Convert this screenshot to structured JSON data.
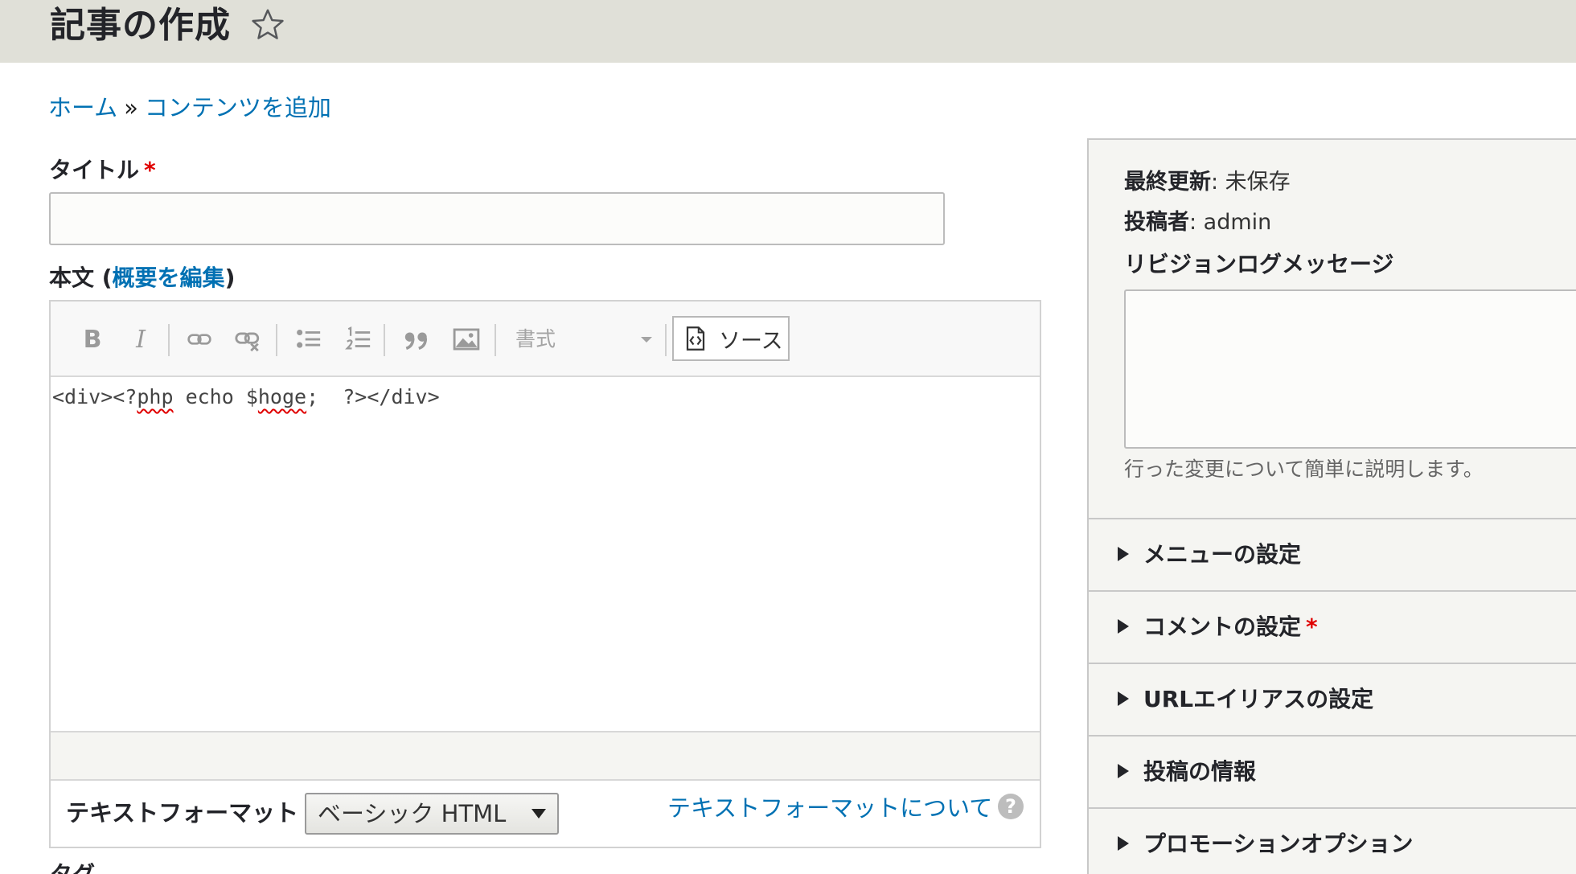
{
  "header": {
    "title": "記事の作成",
    "star_icon": "star-outline-icon"
  },
  "breadcrumb": {
    "home": "ホーム",
    "separator": "»",
    "add_content": "コンテンツを追加"
  },
  "title_field": {
    "label": "タイトル",
    "required_mark": "*",
    "value": ""
  },
  "body_field": {
    "label": "本文 (",
    "edit_summary": "概要を編集",
    "label_close": ")",
    "toolbar": {
      "bold": "B",
      "italic": "I",
      "format_placeholder": "書式",
      "source_label": "ソース"
    },
    "content": {
      "part1": "<div><?",
      "word1": "php",
      "part2": " echo $",
      "word2": "hoge",
      "part3": ";  ?></div>"
    },
    "text_format": {
      "label": "テキストフォーマット",
      "selected": "ベーシック HTML",
      "about_link": "テキストフォーマットについて",
      "help": "?"
    }
  },
  "next_label_partial": "タグ",
  "sidebar": {
    "last_updated_label": "最終更新",
    "last_updated_value": ": 未保存",
    "author_label": "投稿者",
    "author_value": ": admin",
    "revision_label": "リビジョンログメッセージ",
    "revision_value": "",
    "revision_desc": "行った変更について簡単に説明します。",
    "panels": [
      {
        "label": "メニューの設定",
        "required": false
      },
      {
        "label": "コメントの設定",
        "required": true,
        "required_mark": "*"
      },
      {
        "label": "URLエイリアスの設定",
        "required": false
      },
      {
        "label": "投稿の情報",
        "required": false
      },
      {
        "label": "プロモーションオプション",
        "required": false
      }
    ]
  },
  "colors": {
    "link": "#0071b3",
    "required": "#e00000",
    "header_bg": "#e0e0d8"
  }
}
